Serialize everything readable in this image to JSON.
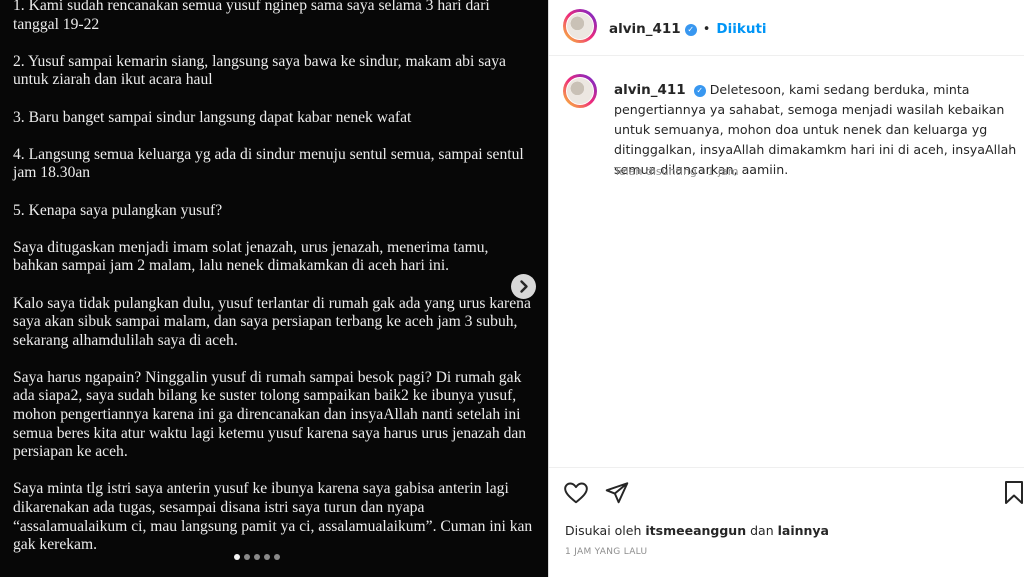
{
  "post": {
    "paragraphs": [
      "1. Kami sudah rencanakan semua yusuf nginep sama saya selama 3 hari dari tanggal 19-22",
      "2. Yusuf sampai kemarin siang, langsung saya bawa ke sindur, makam abi saya untuk ziarah dan ikut acara haul",
      "3. Baru banget sampai sindur langsung dapat kabar nenek wafat",
      "4. Langsung semua keluarga yg ada di sindur menuju sentul semua, sampai sentul jam 18.30an",
      "5. Kenapa saya pulangkan yusuf?",
      "Saya ditugaskan menjadi imam solat jenazah, urus jenazah, menerima tamu, bahkan sampai jam 2 malam, lalu nenek dimakamkan di aceh hari ini.",
      "Kalo saya tidak pulangkan dulu, yusuf terlantar di rumah gak ada yang urus karena saya akan sibuk sampai malam, dan saya persiapan terbang ke aceh jam 3 subuh, sekarang alhamdulilah saya di aceh.",
      "Saya harus ngapain? Ninggalin yusuf di rumah sampai besok pagi? Di rumah gak ada siapa2, saya sudah bilang ke suster tolong sampaikan baik2 ke ibunya yusuf, mohon pengertiannya karena ini ga direncanakan dan insyaAllah nanti setelah ini semua beres kita atur waktu lagi ketemu yusuf karena saya harus urus jenazah dan persiapan ke aceh.",
      "Saya minta tlg istri saya anterin yusuf ke ibunya karena saya gabisa anterin lagi dikarenakan ada tugas, sesampai disana istri saya turun dan nyapa “assalamualaikum ci, mau langsung pamit ya ci, assalamualaikum”. Cuman ini kan gak kerekam."
    ],
    "next_icon": "chevron-right-icon",
    "carousel_dots": 5,
    "active_dot": 0
  },
  "header": {
    "username": "alvin_411",
    "separator": "•",
    "follow_status": "Diikuti"
  },
  "caption": {
    "username": "alvin_411",
    "text": "Deletesoon, kami sedang berduka, minta pengertiannya ya sahabat, semoga menjadi wasilah kebaikan untuk semuanya, mohon doa untuk nenek dan keluarga yg ditinggalkan, insyaAllah dimakamkm hari ini di aceh, insyaAllah semua dilancarkan, aamiin.",
    "edited": "Telah disunting",
    "dot": "·",
    "time": "1 jam"
  },
  "actions": {
    "likes_prefix": "Disukai oleh",
    "liker": "itsmeeanggun",
    "likes_and": "dan",
    "likes_rest": "lainnya",
    "timestamp": "1 JAM YANG LALU"
  },
  "colors": {
    "accent": "#0095f6",
    "verified": "#3897f0",
    "post_bg": "#070707"
  }
}
